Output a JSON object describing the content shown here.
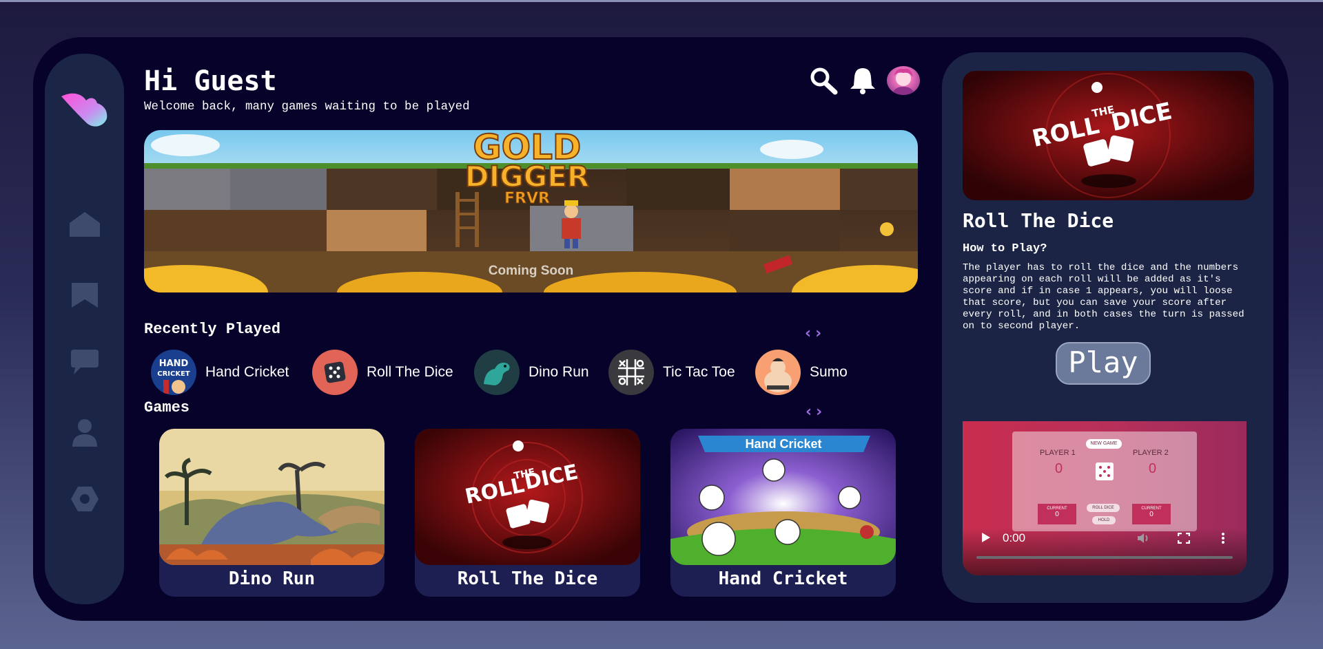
{
  "header": {
    "greeting": "Hi Guest",
    "subtitle": "Welcome back, many games waiting to be played",
    "icons": [
      "search-icon",
      "bell-icon",
      "avatar"
    ]
  },
  "sidebar": {
    "items": [
      {
        "icon": "logo-icon"
      },
      {
        "icon": "home-icon"
      },
      {
        "icon": "bookmark-icon"
      },
      {
        "icon": "chat-icon"
      },
      {
        "icon": "user-icon"
      },
      {
        "icon": "settings-icon"
      }
    ]
  },
  "banner": {
    "title_line1": "GOLD",
    "title_line2": "DIGGER",
    "title_line3": "FRVR",
    "caption": "Coming Soon"
  },
  "recent": {
    "title": "Recently Played",
    "items": [
      {
        "label": "Hand Cricket",
        "thumb_line1": "HAND",
        "thumb_line2": "CRICKET"
      },
      {
        "label": "Roll The Dice"
      },
      {
        "label": "Dino Run"
      },
      {
        "label": "Tic Tac Toe"
      },
      {
        "label": "Sumo"
      }
    ]
  },
  "games": {
    "title": "Games",
    "cards": [
      {
        "title": "Dino Run"
      },
      {
        "title": "Roll The Dice",
        "art_line1": "ROLL",
        "art_line2": "THE",
        "art_line3": "DICE"
      },
      {
        "title": "Hand Cricket",
        "art_banner": "Hand Cricket"
      }
    ]
  },
  "details": {
    "art_line1": "ROLL",
    "art_line2": "THE",
    "art_line3": "DICE",
    "title": "Roll The Dice",
    "howto": "How to Play?",
    "description": "The player has to roll the dice and the numbers appearing on each roll will be added as it's score and if in case 1 appears, you will loose that score, but you can save your score after every roll, and in both cases the turn is passed on to second player.",
    "play_label": "Play"
  },
  "video": {
    "new_game": "NEW GAME",
    "player1": "PLAYER 1",
    "player2": "PLAYER 2",
    "score1": "0",
    "score2": "0",
    "current_label": "CURRENT",
    "current1": "0",
    "current2": "0",
    "roll_dice": "ROLL DICE",
    "hold": "HOLD",
    "time": "0:00"
  },
  "colors": {
    "frame": "#06022a",
    "panel": "#1c2445",
    "accent_arrows": "#9b6fdf",
    "card": "#1d1e52"
  }
}
